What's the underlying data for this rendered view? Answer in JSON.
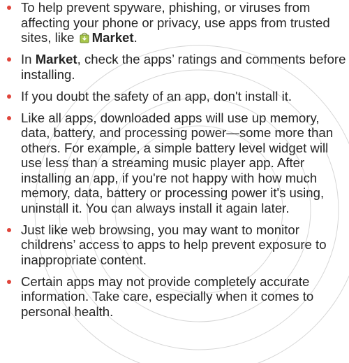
{
  "bullets": [
    {
      "before": "To help prevent spyware, phishing, or viruses from affecting your phone or privacy, use apps from trusted sites, like ",
      "icon": "market-bag-icon",
      "bold": "Market",
      "after": "."
    },
    {
      "before": "In ",
      "bold": "Market",
      "after": ", check the apps’ ratings and comments before installing."
    },
    {
      "text": "If you doubt the safety of an app, don't install it."
    },
    {
      "text": "Like all apps, downloaded apps will use up memory, data, battery, and processing power—some more than others. For example, a simple battery level widget will use less than a streaming music player app. After installing an app, if you're not happy with how much memory, data, battery or processing power it's using, uninstall it. You can always install it again later."
    },
    {
      "text": "Just like web browsing, you may want to monitor childrens’ access to apps to help prevent exposure to inappropriate content."
    },
    {
      "text": "Certain apps may not provide completely accurate information. Take care, especially when it comes to personal health."
    }
  ],
  "colors": {
    "bullet": "#e0443a",
    "text": "#262626",
    "watermark": "#c9c9c9"
  }
}
